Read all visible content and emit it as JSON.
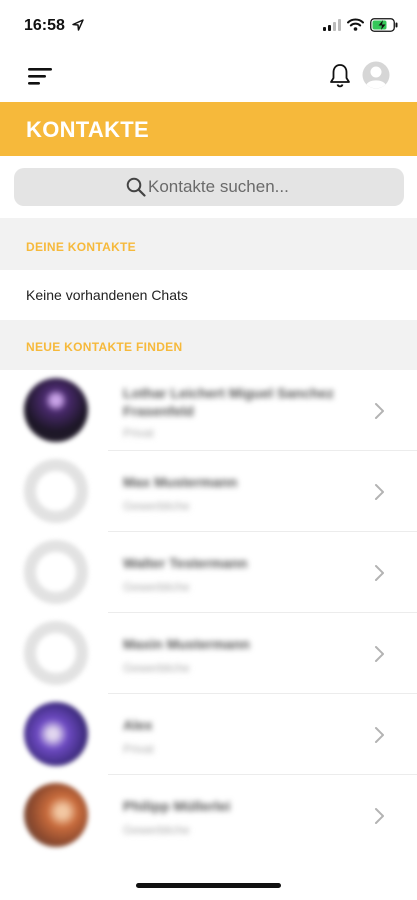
{
  "status_bar": {
    "time": "16:58",
    "icons": [
      "location-arrow-icon",
      "signal-icon",
      "wifi-icon",
      "battery-charging-icon"
    ],
    "battery_color": "#34c759"
  },
  "nav": {
    "icons": [
      "menu-icon",
      "bell-icon",
      "user-avatar-icon"
    ]
  },
  "header": {
    "title": "KONTAKTE",
    "color": "#f6b93b"
  },
  "search": {
    "placeholder": "Kontakte suchen...",
    "value": ""
  },
  "sections": {
    "my_contacts_label": "DEINE KONTAKTE",
    "empty_text": "Keine vorhandenen Chats",
    "find_contacts_label": "NEUE KONTAKTE FINDEN"
  },
  "contacts": [
    {
      "name": "Lothar Leichert Miguel Sanchez Frasenfeld",
      "subtitle": "Privat",
      "avatar": "photo"
    },
    {
      "name": "Max Mustermann",
      "subtitle": "Gewerbliche",
      "avatar": "placeholder"
    },
    {
      "name": "Walter Testermann",
      "subtitle": "Gewerbliche",
      "avatar": "placeholder"
    },
    {
      "name": "Maxin Mustermann",
      "subtitle": "Gewerbliche",
      "avatar": "placeholder"
    },
    {
      "name": "Alex",
      "subtitle": "Privat",
      "avatar": "photo"
    },
    {
      "name": "Philipp Müllerlei",
      "subtitle": "Gewerbliche",
      "avatar": "photo"
    }
  ]
}
